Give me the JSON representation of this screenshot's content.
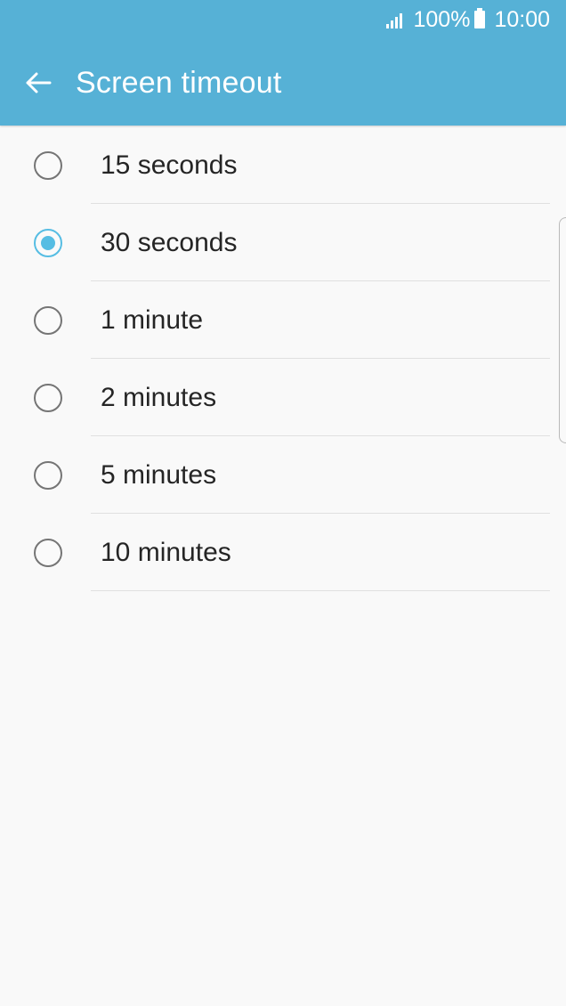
{
  "status_bar": {
    "battery_percent": "100%",
    "time": "10:00"
  },
  "header": {
    "title": "Screen timeout"
  },
  "colors": {
    "header": "#56b1d6",
    "accent": "#56bde3",
    "background": "#f9f9f9"
  },
  "options": [
    {
      "label": "15 seconds",
      "selected": false
    },
    {
      "label": "30 seconds",
      "selected": true
    },
    {
      "label": "1 minute",
      "selected": false
    },
    {
      "label": "2 minutes",
      "selected": false
    },
    {
      "label": "5 minutes",
      "selected": false
    },
    {
      "label": "10 minutes",
      "selected": false
    }
  ],
  "icons": {
    "back": "arrow-left-icon",
    "signal": "signal-icon",
    "battery": "battery-icon"
  }
}
